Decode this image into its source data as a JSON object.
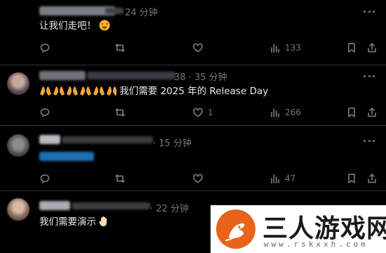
{
  "posts": [
    {
      "time": "24 分钟",
      "text": "让我们走吧！",
      "emoji_after": "smiling-face-with-heart-eyes-emoji",
      "actions": {
        "replies": "",
        "reposts": "",
        "likes": "",
        "views": "133"
      }
    },
    {
      "time_prefix": "38 ·",
      "time": "35 分钟",
      "text": "我们需要 2025 年的 Release Day",
      "emoji_before": "folded-hands-emoji",
      "actions": {
        "replies": "",
        "reposts": "",
        "likes": "1",
        "views": "266"
      }
    },
    {
      "time": "15 分钟",
      "text": "",
      "actions": {
        "replies": "",
        "reposts": "",
        "likes": "",
        "views": "47"
      }
    },
    {
      "time": "22 分钟",
      "text": "我们需要演示",
      "emoji_after": "raised-hand-emoji",
      "actions": {}
    }
  ],
  "watermark": {
    "title": "三人游戏网",
    "url": "www.rskxxh.com"
  },
  "colors": {
    "background": "#000000",
    "text": "#e7e9ea",
    "muted": "#71767b",
    "divider": "#2f3336",
    "link_blur": "#1d9bf0",
    "heart_eyes": "#f7b928",
    "praying_hands": "#f4a53a",
    "watermark_orange": "#e8641b"
  }
}
